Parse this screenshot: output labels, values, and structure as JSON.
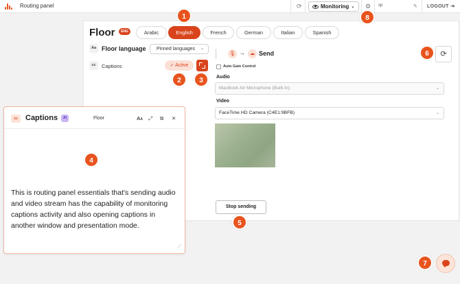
{
  "topbar": {
    "app_title": "Routing panel",
    "monitoring_label": "Monitoring",
    "user_initials": "sp",
    "logout_label": "LOGOUT",
    "logo_icon": "audio-wave-icon",
    "accent_color": "#e8541e"
  },
  "floor": {
    "title": "Floor",
    "language_badge": "ENG",
    "languages": [
      "Arabic",
      "English",
      "French",
      "German",
      "Italian",
      "Spanish"
    ],
    "selected_language": "English"
  },
  "floor_language": {
    "icon_text": "Aa",
    "label": "Floor language",
    "select_value": "Pinned languages"
  },
  "captions_row": {
    "icon_text": "cc",
    "label": "Captions",
    "status": "✓ Active"
  },
  "send": {
    "label": "Send",
    "auto_gain_label": "Auto Gain Control",
    "audio_label": "Audio",
    "audio_device": "MacBook Air Microphone (Built-In)",
    "video_label": "Video",
    "video_device": "FaceTime HD Camera (C4E1:9BFB)",
    "stop_label": "Stop sending"
  },
  "captions_window": {
    "badge": "cc",
    "title": "Captions",
    "ai_badge": "AI",
    "channel": "Floor",
    "text": "This is routing panel essentials that's sending audio and video stream has the capability of monitoring captions activity and also opening captions in another window and presentation mode."
  },
  "callouts": [
    "1",
    "2",
    "3",
    "4",
    "5",
    "6",
    "7",
    "8"
  ]
}
